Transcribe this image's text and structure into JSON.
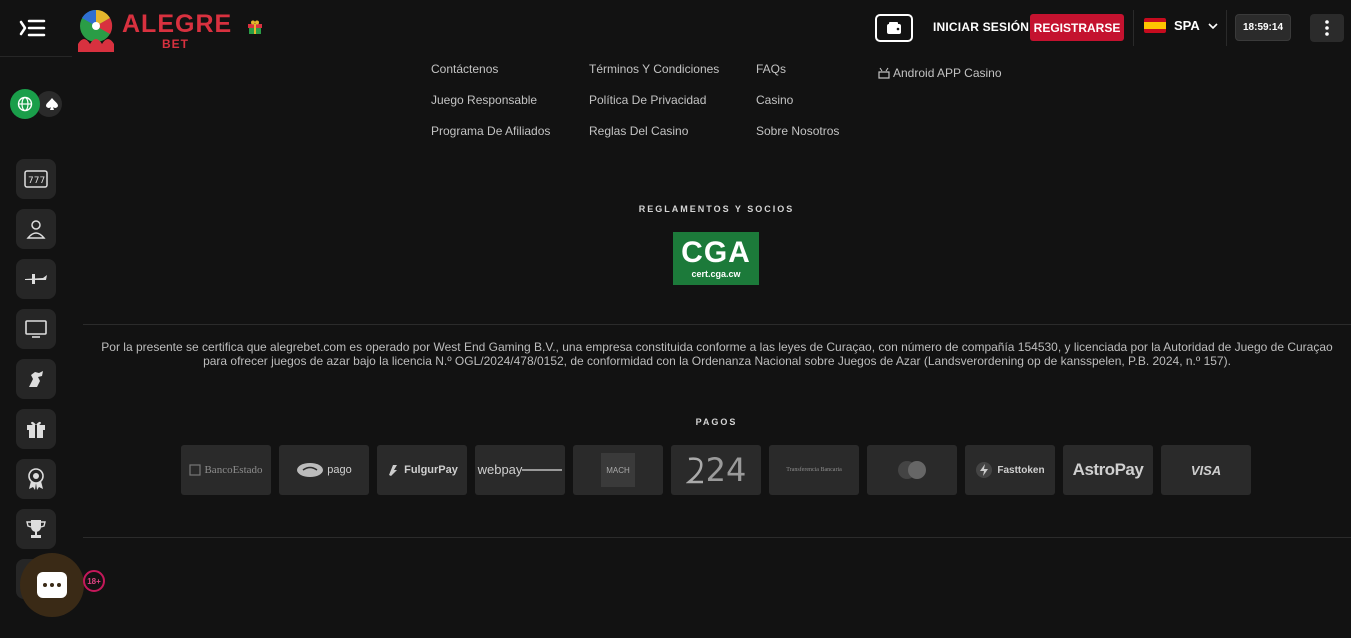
{
  "header": {
    "logo_text": "ALEGRE",
    "logo_sub": "BET",
    "login_label": "INICIAR SESIÓN",
    "register_label": "REGISTRARSE",
    "language_label": "SPA",
    "clock": "18:59:14",
    "colors": {
      "brand": "#d8313f",
      "register": "#c4122f"
    }
  },
  "sidebar": {
    "items": [
      {
        "name": "slots-icon"
      },
      {
        "name": "live-dealer-icon"
      },
      {
        "name": "aviator-icon"
      },
      {
        "name": "tv-games-icon"
      },
      {
        "name": "horse-racing-icon"
      },
      {
        "name": "gift-icon"
      },
      {
        "name": "award-icon"
      },
      {
        "name": "trophy-icon"
      }
    ]
  },
  "footer": {
    "links_col1": [
      "Contáctenos",
      "Juego Responsable",
      "Programa De Afiliados"
    ],
    "links_col2": [
      "Términos Y Condiciones",
      "Política De Privacidad",
      "Reglas Del Casino"
    ],
    "links_col3": [
      "FAQs",
      "Casino",
      "Sobre Nosotros"
    ],
    "android_link": "Android APP Casino",
    "regulations_title": "REGLAMENTOS Y SOCIOS",
    "cga_big": "CGA",
    "cga_small": "cert.cga.cw",
    "legal_text": "Por la presente se certifica que alegrebet.com es operado por West End Gaming B.V., una empresa constituida conforme a las leyes de Curaçao, con número de compañía 154530, y licenciada por la Autoridad de Juego de Curaçao para ofrecer juegos de azar bajo la licencia N.º OGL/2024/478/0152, de conformidad con la Ordenanza Nacional sobre Juegos de Azar (Landsverordening op de kansspelen, P.B. 2024, n.º 157).",
    "payments_title": "PAGOS",
    "payments": [
      "BancoEstado",
      "pago",
      "FulgurPay",
      "webpay",
      "MACH",
      "24",
      "Transferencia Bancaria",
      "Mastercard",
      "Fasttoken",
      "AstroPay",
      "VISA"
    ],
    "age_badge": "18+"
  }
}
